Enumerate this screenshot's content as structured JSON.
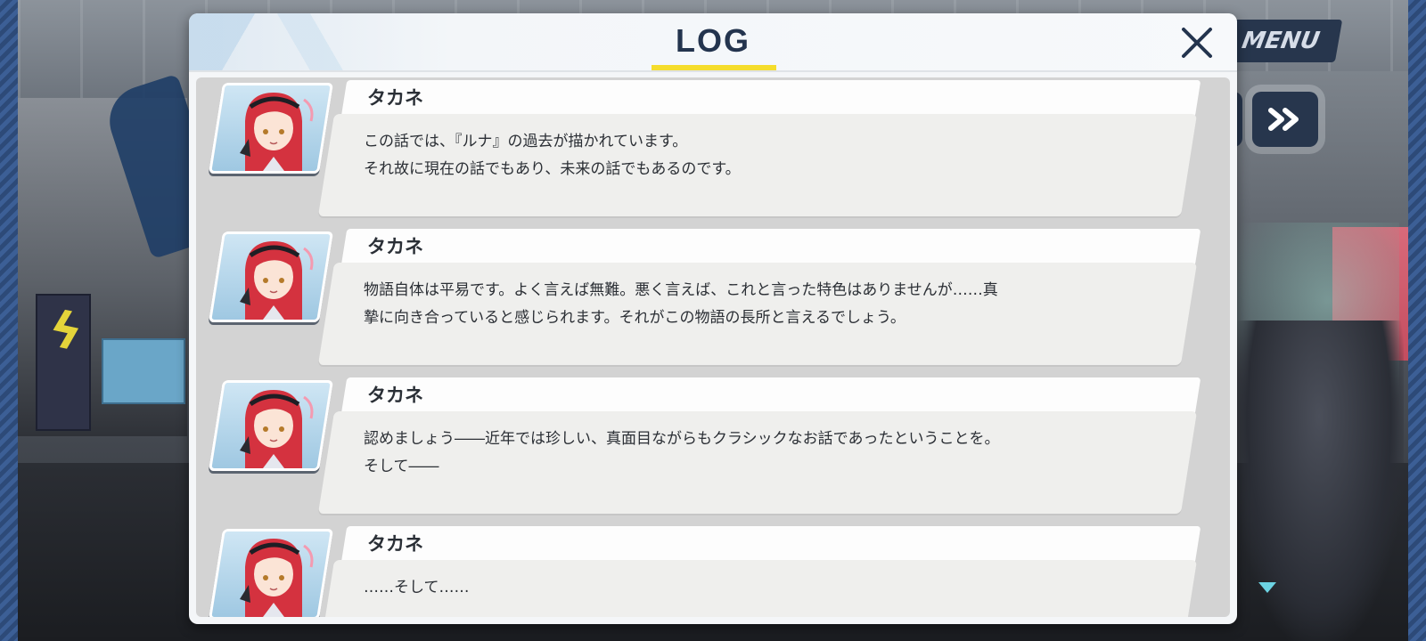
{
  "background": {
    "menu_label": "MENU",
    "fastforward_icon": "fast-forward-icon"
  },
  "log": {
    "title": "LOG",
    "accent_color": "#f5dd2c",
    "title_color": "#23344e",
    "close_icon": "close-icon",
    "entries": [
      {
        "speaker": "タカネ",
        "portrait": "takane-portrait",
        "text": "この話では、『ルナ』の過去が描かれています。\nそれ故に現在の話でもあり、未来の話でもあるのです。"
      },
      {
        "speaker": "タカネ",
        "portrait": "takane-portrait",
        "text": "物語自体は平易です。よく言えば無難。悪く言えば、これと言った特色はありませんが……真\n摯に向き合っていると感じられます。それがこの物語の長所と言えるでしょう。"
      },
      {
        "speaker": "タカネ",
        "portrait": "takane-portrait",
        "text": "認めましょう――近年では珍しい、真面目ながらもクラシックなお話であったということを。\nそして――"
      },
      {
        "speaker": "タカネ",
        "portrait": "takane-portrait",
        "text": "……そして……"
      }
    ]
  }
}
